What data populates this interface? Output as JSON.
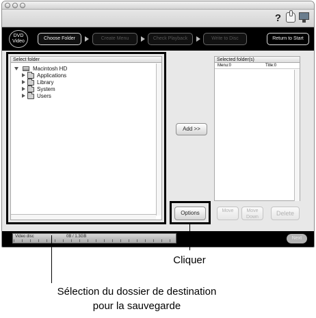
{
  "toolbar": {
    "help_glyph": "?"
  },
  "steps": {
    "logo_line1": "DVD",
    "logo_line2": "Video",
    "choose_folder": "Choose Folder",
    "create_menu": "Create Menu",
    "check_playback": "Check Playback",
    "write_to_disc": "Write to Disc",
    "return_to_start": "Return to Start"
  },
  "folder_panel": {
    "header": "Select folder",
    "tree": [
      {
        "label": "Macintosh HD",
        "icon": "hard-disk-icon",
        "expanded": true
      },
      {
        "label": "Applications",
        "icon": "folder-icon",
        "expanded": false
      },
      {
        "label": "Library",
        "icon": "folder-icon",
        "expanded": false
      },
      {
        "label": "System",
        "icon": "folder-icon",
        "expanded": false
      },
      {
        "label": "Users",
        "icon": "folder-icon",
        "expanded": false
      }
    ]
  },
  "selected_panel": {
    "header": "Selected folder(s)",
    "menu_label": "Menu:0",
    "title_label": "Title:0"
  },
  "buttons": {
    "add": "Add >>",
    "options": "Options",
    "move_up": "Move",
    "move_down_line1": "Move",
    "move_down_line2": "Down",
    "delete": "Delete",
    "next": "Next"
  },
  "status": {
    "disc_type": "Video disc",
    "used": "0B  / 1.3GB",
    "used_fraction": 0
  },
  "captions": {
    "click": "Cliquer",
    "select_line1": "Sélection du dossier de destination",
    "select_line2": "pour la sauvegarde"
  },
  "colors": {
    "step_bar": "#000000",
    "highlight_border": "#000000",
    "window_background": "#e6e6e6"
  }
}
